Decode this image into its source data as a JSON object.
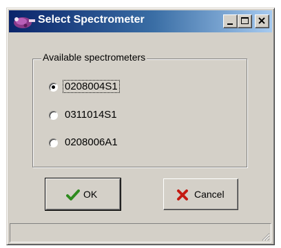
{
  "window": {
    "title": "Select Spectrometer",
    "controls": {
      "minimize": "minimize",
      "maximize": "maximize",
      "close": "close"
    }
  },
  "group": {
    "label": "Available spectrometers",
    "options": [
      {
        "label": "0208004S1",
        "selected": true
      },
      {
        "label": "0311014S1",
        "selected": false
      },
      {
        "label": "0208006A1",
        "selected": false
      }
    ]
  },
  "buttons": {
    "ok_label": "OK",
    "cancel_label": "Cancel"
  },
  "icons": {
    "app": "spectrometer-app-icon",
    "ok": "checkmark-icon",
    "cancel": "x-cross-icon"
  },
  "colors": {
    "titlebar_start": "#0a246a",
    "titlebar_end": "#a6caf0",
    "window_bg": "#d4d0c8",
    "ok_check": "#2e8b1e",
    "cancel_x": "#c41a12"
  }
}
